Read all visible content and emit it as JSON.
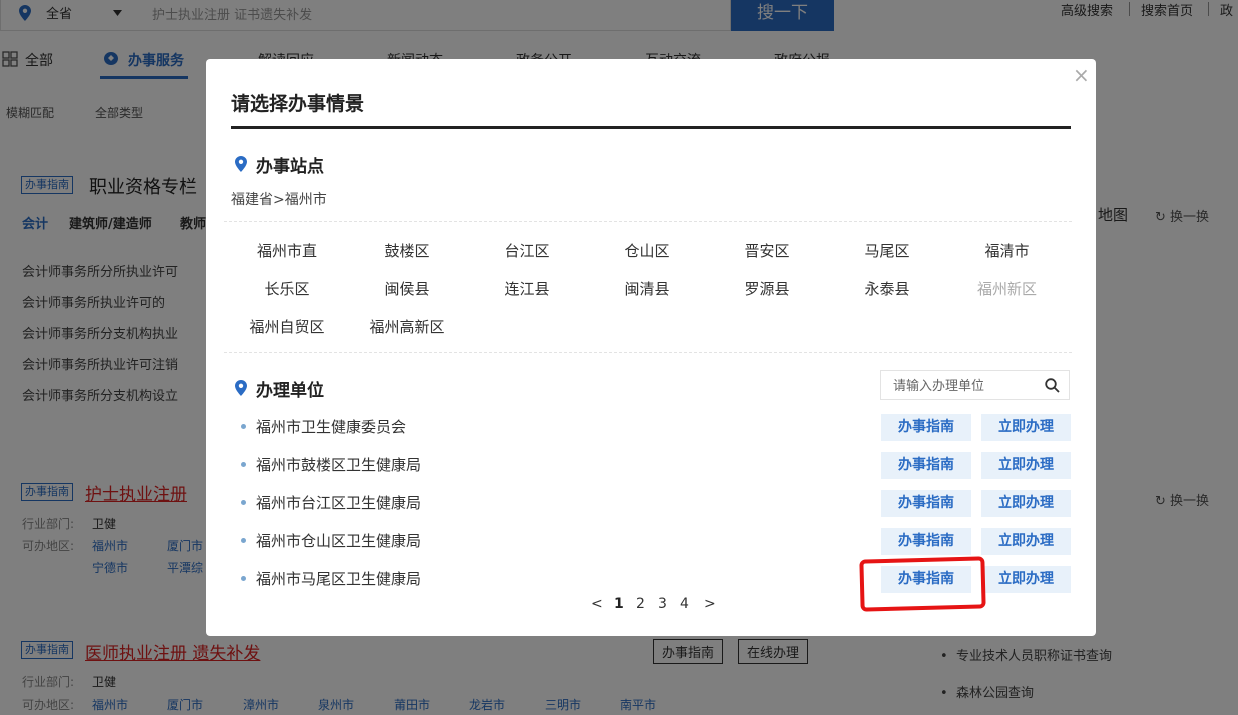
{
  "header": {
    "location": "全省",
    "search_placeholder": "护士执业注册 证书遗失补发",
    "search_button": "搜一下",
    "links": [
      "高级搜索",
      "搜索首页",
      "政"
    ]
  },
  "nav": {
    "items": [
      "全部",
      "办事服务",
      "解读回应",
      "新闻动态",
      "政务公开",
      "互动交流",
      "政府公报"
    ]
  },
  "filters": [
    "模糊匹配",
    "全部类型"
  ],
  "background": {
    "tag": "办事指南",
    "section_title": "职业资格专栏",
    "tabs": [
      "会计",
      "建筑师/建造师",
      "教师"
    ],
    "bullets": [
      "会计师事务所分所执业许可",
      "会计师事务所执业许可的",
      "会计师事务所分支机构执业",
      "会计师事务所执业许可注销",
      "会计师事务所分支机构设立"
    ],
    "right_title": "地图",
    "refresh": "换一换",
    "item1": {
      "title": "护士执业注册",
      "dept_label": "行业部门:",
      "dept_value": "卫健",
      "area_label": "可办地区:",
      "areas": [
        "福州市",
        "厦门市",
        "宁德市",
        "平潭综"
      ]
    },
    "item2": {
      "title": "医师执业注册 遗失补发",
      "dept_label": "行业部门:",
      "dept_value": "卫健",
      "area_label": "可办地区:",
      "areas": [
        "福州市",
        "厦门市",
        "漳州市",
        "泉州市",
        "莆田市",
        "龙岩市",
        "三明市",
        "南平市"
      ],
      "buttons": [
        "办事指南",
        "在线办理"
      ]
    },
    "right_list": [
      "专业技术人员职称证书查询",
      "森林公园查询"
    ]
  },
  "modal": {
    "title": "请选择办事情景",
    "close": "×",
    "station_heading": "办事站点",
    "breadcrumb": "福建省>福州市",
    "districts": [
      {
        "name": "福州市直"
      },
      {
        "name": "鼓楼区"
      },
      {
        "name": "台江区"
      },
      {
        "name": "仓山区"
      },
      {
        "name": "晋安区"
      },
      {
        "name": "马尾区"
      },
      {
        "name": "福清市"
      },
      {
        "name": "长乐区"
      },
      {
        "name": "闽侯县"
      },
      {
        "name": "连江县"
      },
      {
        "name": "闽清县"
      },
      {
        "name": "罗源县"
      },
      {
        "name": "永泰县"
      },
      {
        "name": "福州新区",
        "disabled": true
      },
      {
        "name": "福州自贸区"
      },
      {
        "name": "福州高新区"
      }
    ],
    "unit_heading": "办理单位",
    "unit_search_placeholder": "请输入办理单位",
    "guide_label": "办事指南",
    "handle_label": "立即办理",
    "departments": [
      "福州市卫生健康委员会",
      "福州市鼓楼区卫生健康局",
      "福州市台江区卫生健康局",
      "福州市仓山区卫生健康局",
      "福州市马尾区卫生健康局"
    ],
    "pagination": {
      "prev": "<",
      "pages": [
        "1",
        "2",
        "3",
        "4"
      ],
      "current": "1",
      "next": ">"
    }
  },
  "colors": {
    "accent": "#2b6cc4",
    "highlight": "#e61414",
    "button_bg": "#e8f1fa"
  }
}
